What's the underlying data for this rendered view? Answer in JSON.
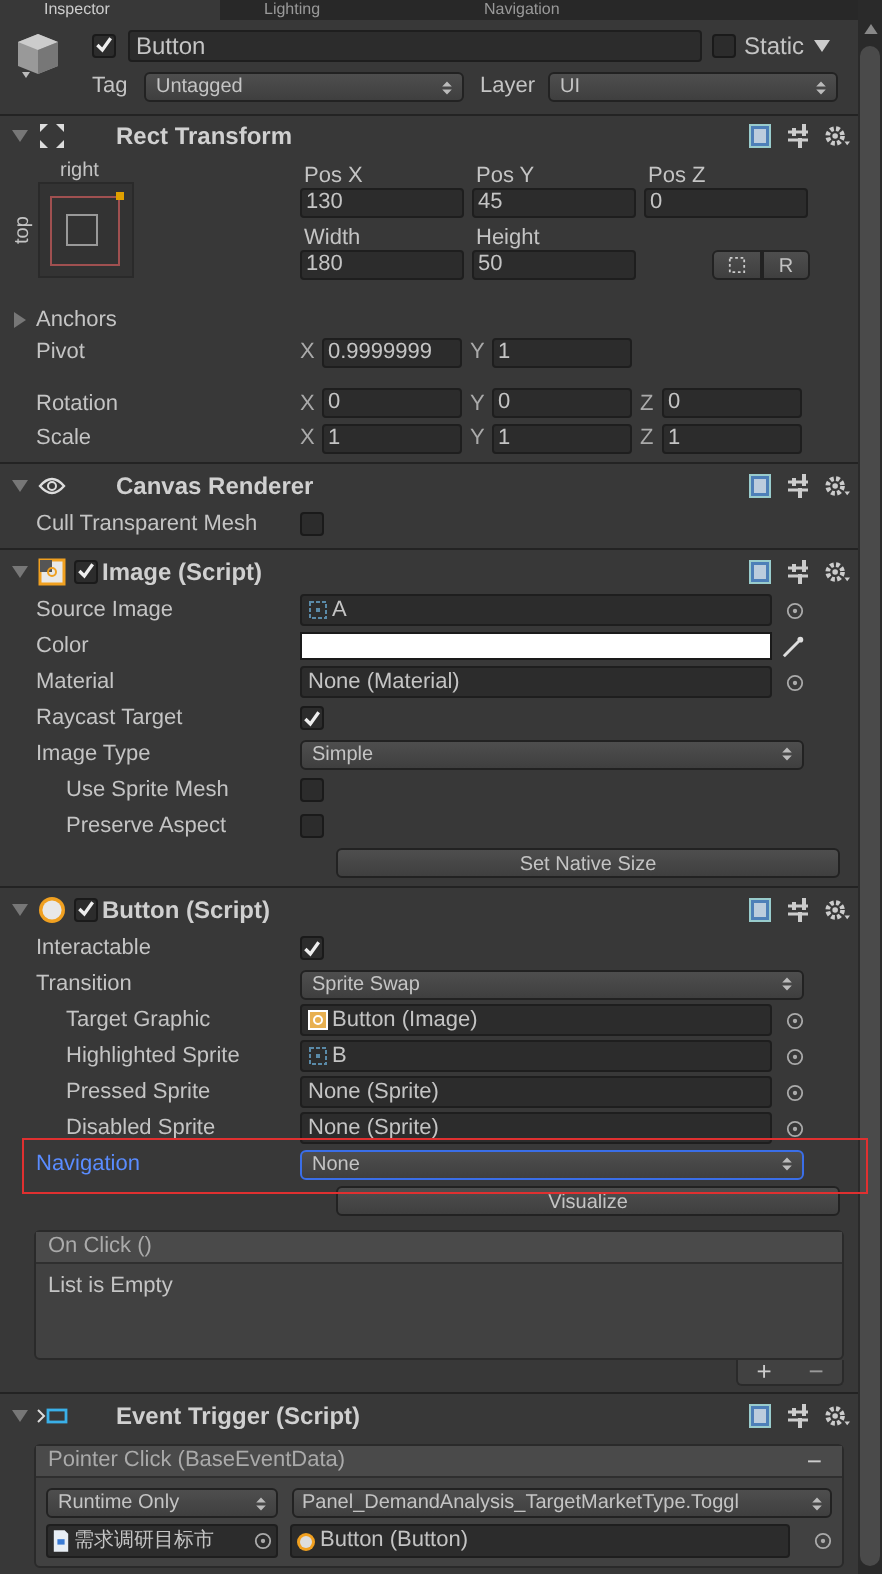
{
  "tabs": [
    {
      "label": "Inspector",
      "selected": true
    },
    {
      "label": "Lighting",
      "selected": false
    },
    {
      "label": "Navigation",
      "selected": false
    }
  ],
  "object": {
    "active": true,
    "name": "Button",
    "static": false,
    "static_label": "Static",
    "tag_label": "Tag",
    "tag": "Untagged",
    "layer_label": "Layer",
    "layer": "UI"
  },
  "rect_transform": {
    "title": "Rect Transform",
    "expanded": true,
    "anchor_h": "right",
    "anchor_v": "top",
    "position": [
      {
        "label": "Pos X",
        "value": "130"
      },
      {
        "label": "Pos Y",
        "value": "45"
      },
      {
        "label": "Pos Z",
        "value": "0"
      }
    ],
    "size": [
      {
        "label": "Width",
        "value": "180"
      },
      {
        "label": "Height",
        "value": "50"
      }
    ],
    "raw_button": "R",
    "anchors": {
      "label": "Anchors",
      "expanded": false
    },
    "vectors": [
      {
        "label": "Pivot",
        "fields": [
          {
            "axis": "X",
            "value": "0.9999999"
          },
          {
            "axis": "Y",
            "value": "1"
          }
        ]
      },
      {
        "label": "Rotation",
        "fields": [
          {
            "axis": "X",
            "value": "0"
          },
          {
            "axis": "Y",
            "value": "0"
          },
          {
            "axis": "Z",
            "value": "0"
          }
        ]
      },
      {
        "label": "Scale",
        "fields": [
          {
            "axis": "X",
            "value": "1"
          },
          {
            "axis": "Y",
            "value": "1"
          },
          {
            "axis": "Z",
            "value": "1"
          }
        ]
      }
    ]
  },
  "components": [
    {
      "kind": "eye",
      "title": "Canvas Renderer",
      "expanded": true,
      "rows": [
        {
          "kind": "check",
          "label": "Cull Transparent Mesh",
          "checked": false
        }
      ]
    },
    {
      "kind": "image",
      "title": "Image (Script)",
      "expanded": true,
      "enabled": true,
      "rows": [
        {
          "kind": "sprite_object",
          "label": "Source Image",
          "value": "A"
        },
        {
          "kind": "color",
          "label": "Color",
          "color": "#ffffff"
        },
        {
          "kind": "object",
          "label": "Material",
          "value": "None (Material)"
        },
        {
          "kind": "check",
          "label": "Raycast Target",
          "checked": true
        },
        {
          "kind": "dropdown",
          "label": "Image Type",
          "value": "Simple"
        },
        {
          "kind": "check",
          "label": "Use Sprite Mesh",
          "checked": false,
          "indent": true
        },
        {
          "kind": "check",
          "label": "Preserve Aspect",
          "checked": false,
          "indent": true
        },
        {
          "kind": "button",
          "label": "Set Native Size"
        }
      ]
    },
    {
      "kind": "button",
      "title": "Button (Script)",
      "expanded": true,
      "enabled": true,
      "rows": [
        {
          "kind": "check",
          "label": "Interactable",
          "checked": true
        },
        {
          "kind": "dropdown",
          "label": "Transition",
          "value": "Sprite Swap"
        },
        {
          "kind": "image_object",
          "label": "Target Graphic",
          "value": "Button (Image)",
          "indent": true
        },
        {
          "kind": "sprite_object",
          "label": "Highlighted Sprite",
          "value": "B",
          "indent": true
        },
        {
          "kind": "object",
          "label": "Pressed Sprite",
          "value": "None (Sprite)",
          "indent": true
        },
        {
          "kind": "object",
          "label": "Disabled Sprite",
          "value": "None (Sprite)",
          "indent": true
        },
        {
          "kind": "dropdown",
          "label": "Navigation",
          "value": "None",
          "focused": true,
          "marked": true
        },
        {
          "kind": "button",
          "label": "Visualize"
        },
        {
          "kind": "event_list",
          "title": "On Click ()",
          "empty_text": "List is Empty",
          "add": "+",
          "remove": "−"
        }
      ]
    },
    {
      "kind": "event",
      "title": "Event Trigger (Script)",
      "expanded": true,
      "rows": [
        {
          "kind": "trigger",
          "title": "Pointer Click (BaseEventData)",
          "remove": "−",
          "mode": "Runtime Only",
          "function": "Panel_DemandAnalysis_TargetMarketType.Toggl",
          "object": "需求调研目标市",
          "target": "Button (Button)"
        }
      ]
    }
  ]
}
